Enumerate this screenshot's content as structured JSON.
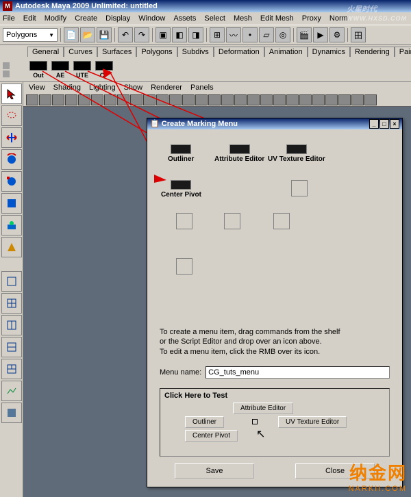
{
  "window": {
    "title": "Autodesk Maya 2009 Unlimited: untitled"
  },
  "menu": [
    "File",
    "Edit",
    "Modify",
    "Create",
    "Display",
    "Window",
    "Assets",
    "Select",
    "Mesh",
    "Edit Mesh",
    "Proxy",
    "Norm"
  ],
  "mode_dropdown": "Polygons",
  "shelf_tabs": [
    "General",
    "Curves",
    "Surfaces",
    "Polygons",
    "Subdivs",
    "Deformation",
    "Animation",
    "Dynamics",
    "Rendering",
    "PaintEffects"
  ],
  "shelf_items": [
    {
      "label": "Out"
    },
    {
      "label": "AE"
    },
    {
      "label": "UTE"
    },
    {
      "label": "CP"
    }
  ],
  "view_menu": [
    "View",
    "Shading",
    "Lighting",
    "Show",
    "Renderer",
    "Panels"
  ],
  "dialog": {
    "title": "Create Marking Menu",
    "slots": {
      "nw": "Outliner",
      "n": "Attribute Editor",
      "ne": "UV Texture Editor",
      "w": "Center Pivot"
    },
    "help1": "To create a menu item, drag commands from the shelf",
    "help2": "or the Script Editor and drop over an icon above.",
    "help3": "To edit a menu item, click the RMB over its icon.",
    "menu_name_label": "Menu name:",
    "menu_name_value": "CG_tuts_menu",
    "test_header": "Click Here to Test",
    "test_buttons": {
      "n": "Attribute Editor",
      "w": "Outliner",
      "e": "UV Texture Editor",
      "sw": "Center Pivot"
    },
    "save": "Save",
    "close": "Close"
  },
  "watermark_top": {
    "main": "火星时代",
    "sub": "WWW.HXSD.COM"
  },
  "watermark_bot": {
    "main": "纳金网",
    "sub": "NARKII.COM"
  }
}
